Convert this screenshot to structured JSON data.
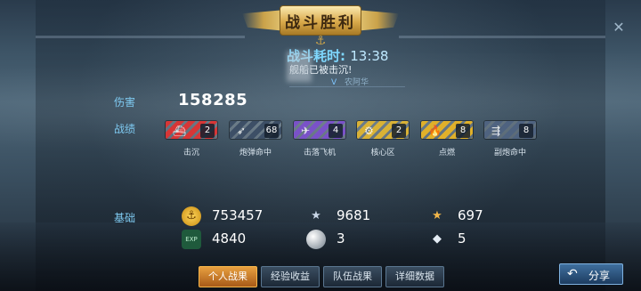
{
  "banner": {
    "title": "战斗胜利"
  },
  "battle": {
    "duration_label": "战斗耗时:",
    "duration_value": "13:38",
    "sunk_message": "舰船已被击沉!",
    "sunk_tag": "V",
    "sunk_ship": "农阿华"
  },
  "labels": {
    "damage": "伤害",
    "record": "战绩",
    "base": "基础"
  },
  "damage_value": "158285",
  "medals": [
    {
      "label": "击沉",
      "count": "2",
      "color": "#d73636",
      "icon": "ship-icon"
    },
    {
      "label": "炮弹命中",
      "count": "68",
      "color": "#3d4f66",
      "icon": "shell-icon"
    },
    {
      "label": "击落飞机",
      "count": "4",
      "color": "#7a52c8",
      "icon": "plane-icon"
    },
    {
      "label": "核心区",
      "count": "2",
      "color": "#d9b236",
      "icon": "core-icon"
    },
    {
      "label": "点燃",
      "count": "8",
      "color": "#e0b02a",
      "icon": "fire-icon"
    },
    {
      "label": "副炮命中",
      "count": "8",
      "color": "#4f6380",
      "icon": "secondary-gun-icon"
    }
  ],
  "resources": [
    {
      "name": "gold-coin-icon",
      "value": "753457",
      "glyph": "⚓",
      "color": "#e0a020"
    },
    {
      "name": "silver-star-icon",
      "value": "9681",
      "glyph": "★",
      "color": "#c8d6e6"
    },
    {
      "name": "gold-star-icon",
      "value": "697",
      "glyph": "★",
      "color": "#f2b64a"
    },
    {
      "name": "exp-badge-icon",
      "value": "4840",
      "glyph": "EXP",
      "color": "#2f7a54"
    },
    {
      "name": "silver-orb-icon",
      "value": "3",
      "glyph": "●",
      "color": "#b8c4d0"
    },
    {
      "name": "diamond-icon",
      "value": "5",
      "glyph": "◆",
      "color": "#e4ecf4"
    }
  ],
  "tabs": [
    {
      "label": "个人战果",
      "active": true
    },
    {
      "label": "经验收益",
      "active": false
    },
    {
      "label": "队伍战果",
      "active": false
    },
    {
      "label": "详细数据",
      "active": false
    }
  ],
  "share_label": "分享",
  "close_glyph": "✕"
}
